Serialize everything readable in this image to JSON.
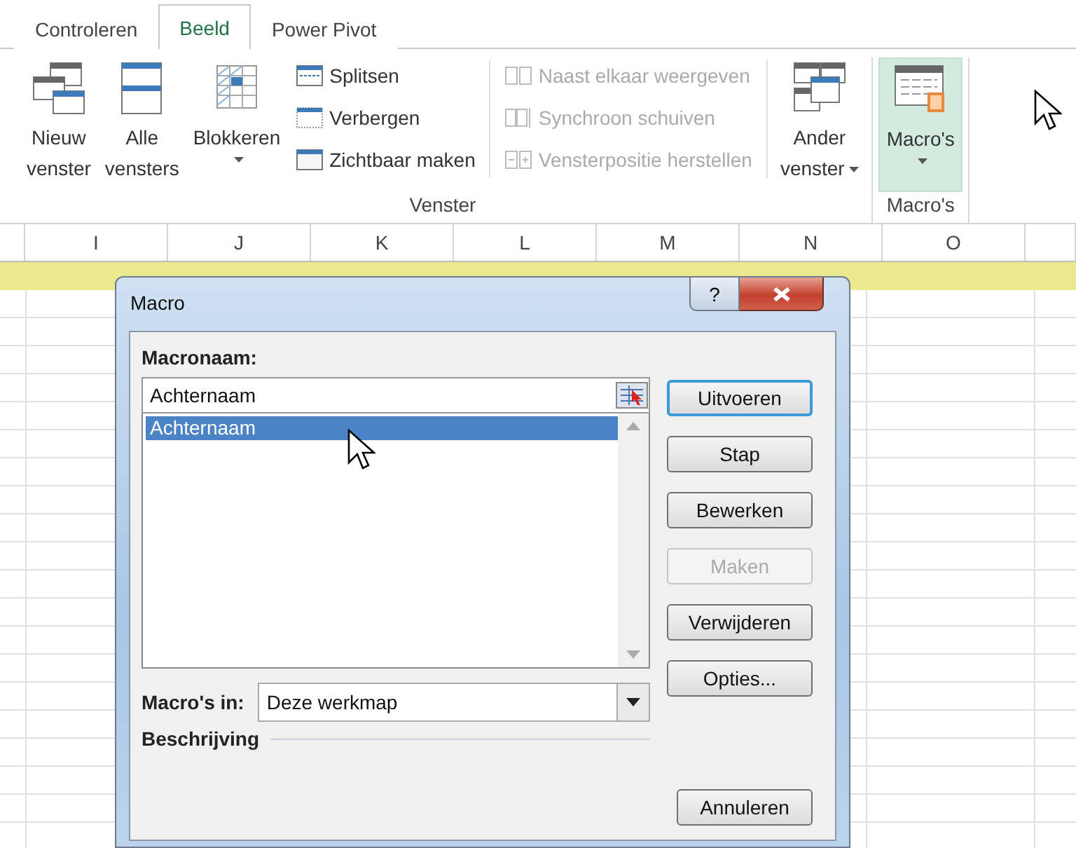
{
  "tabs": [
    {
      "label": "Controleren",
      "selected": false
    },
    {
      "label": "Beeld",
      "selected": true
    },
    {
      "label": "Power Pivot",
      "selected": false
    }
  ],
  "ribbon": {
    "groups": [
      {
        "label": "Venster",
        "items": [
          {
            "kind": "large",
            "lines": [
              "Nieuw",
              "venster"
            ],
            "dropdown": false,
            "highlighted": false
          },
          {
            "kind": "large",
            "lines": [
              "Alle",
              "vensters"
            ],
            "dropdown": false,
            "highlighted": false
          },
          {
            "kind": "large",
            "lines": [
              "Blokkeren"
            ],
            "dropdown": true,
            "highlighted": false
          },
          {
            "kind": "stack",
            "items": [
              {
                "label": "Splitsen",
                "disabled": false
              },
              {
                "label": "Verbergen",
                "disabled": false
              },
              {
                "label": "Zichtbaar maken",
                "disabled": false
              }
            ]
          },
          {
            "kind": "stack",
            "items": [
              {
                "label": "Naast elkaar weergeven",
                "disabled": true
              },
              {
                "label": "Synchroon schuiven",
                "disabled": true
              },
              {
                "label": "Vensterpositie herstellen",
                "disabled": true
              }
            ]
          },
          {
            "kind": "large",
            "lines": [
              "Ander",
              "venster"
            ],
            "dropdown": true,
            "highlighted": false
          }
        ]
      },
      {
        "label": "Macro's",
        "items": [
          {
            "kind": "large",
            "lines": [
              "Macro's"
            ],
            "dropdown": true,
            "highlighted": true
          }
        ]
      }
    ]
  },
  "sheet": {
    "columns": [
      "I",
      "J",
      "K",
      "L",
      "M",
      "N",
      "O"
    ]
  },
  "dialog": {
    "title": "Macro",
    "help": "?",
    "name_label": "Macronaam:",
    "name_value": "Achternaam",
    "list": [
      {
        "label": "Achternaam",
        "selected": true
      }
    ],
    "buttons": [
      {
        "label": "Uitvoeren",
        "disabled": false,
        "default": true
      },
      {
        "label": "Stap",
        "disabled": false,
        "default": false
      },
      {
        "label": "Bewerken",
        "disabled": false,
        "default": false
      },
      {
        "label": "Maken",
        "disabled": true,
        "default": false
      },
      {
        "label": "Verwijderen",
        "disabled": false,
        "default": false
      },
      {
        "label": "Opties...",
        "disabled": false,
        "default": false
      }
    ],
    "macros_in": {
      "label": "Macro's in:",
      "value": "Deze werkmap"
    },
    "description_label": "Beschrijving",
    "cancel": "Annuleren"
  }
}
